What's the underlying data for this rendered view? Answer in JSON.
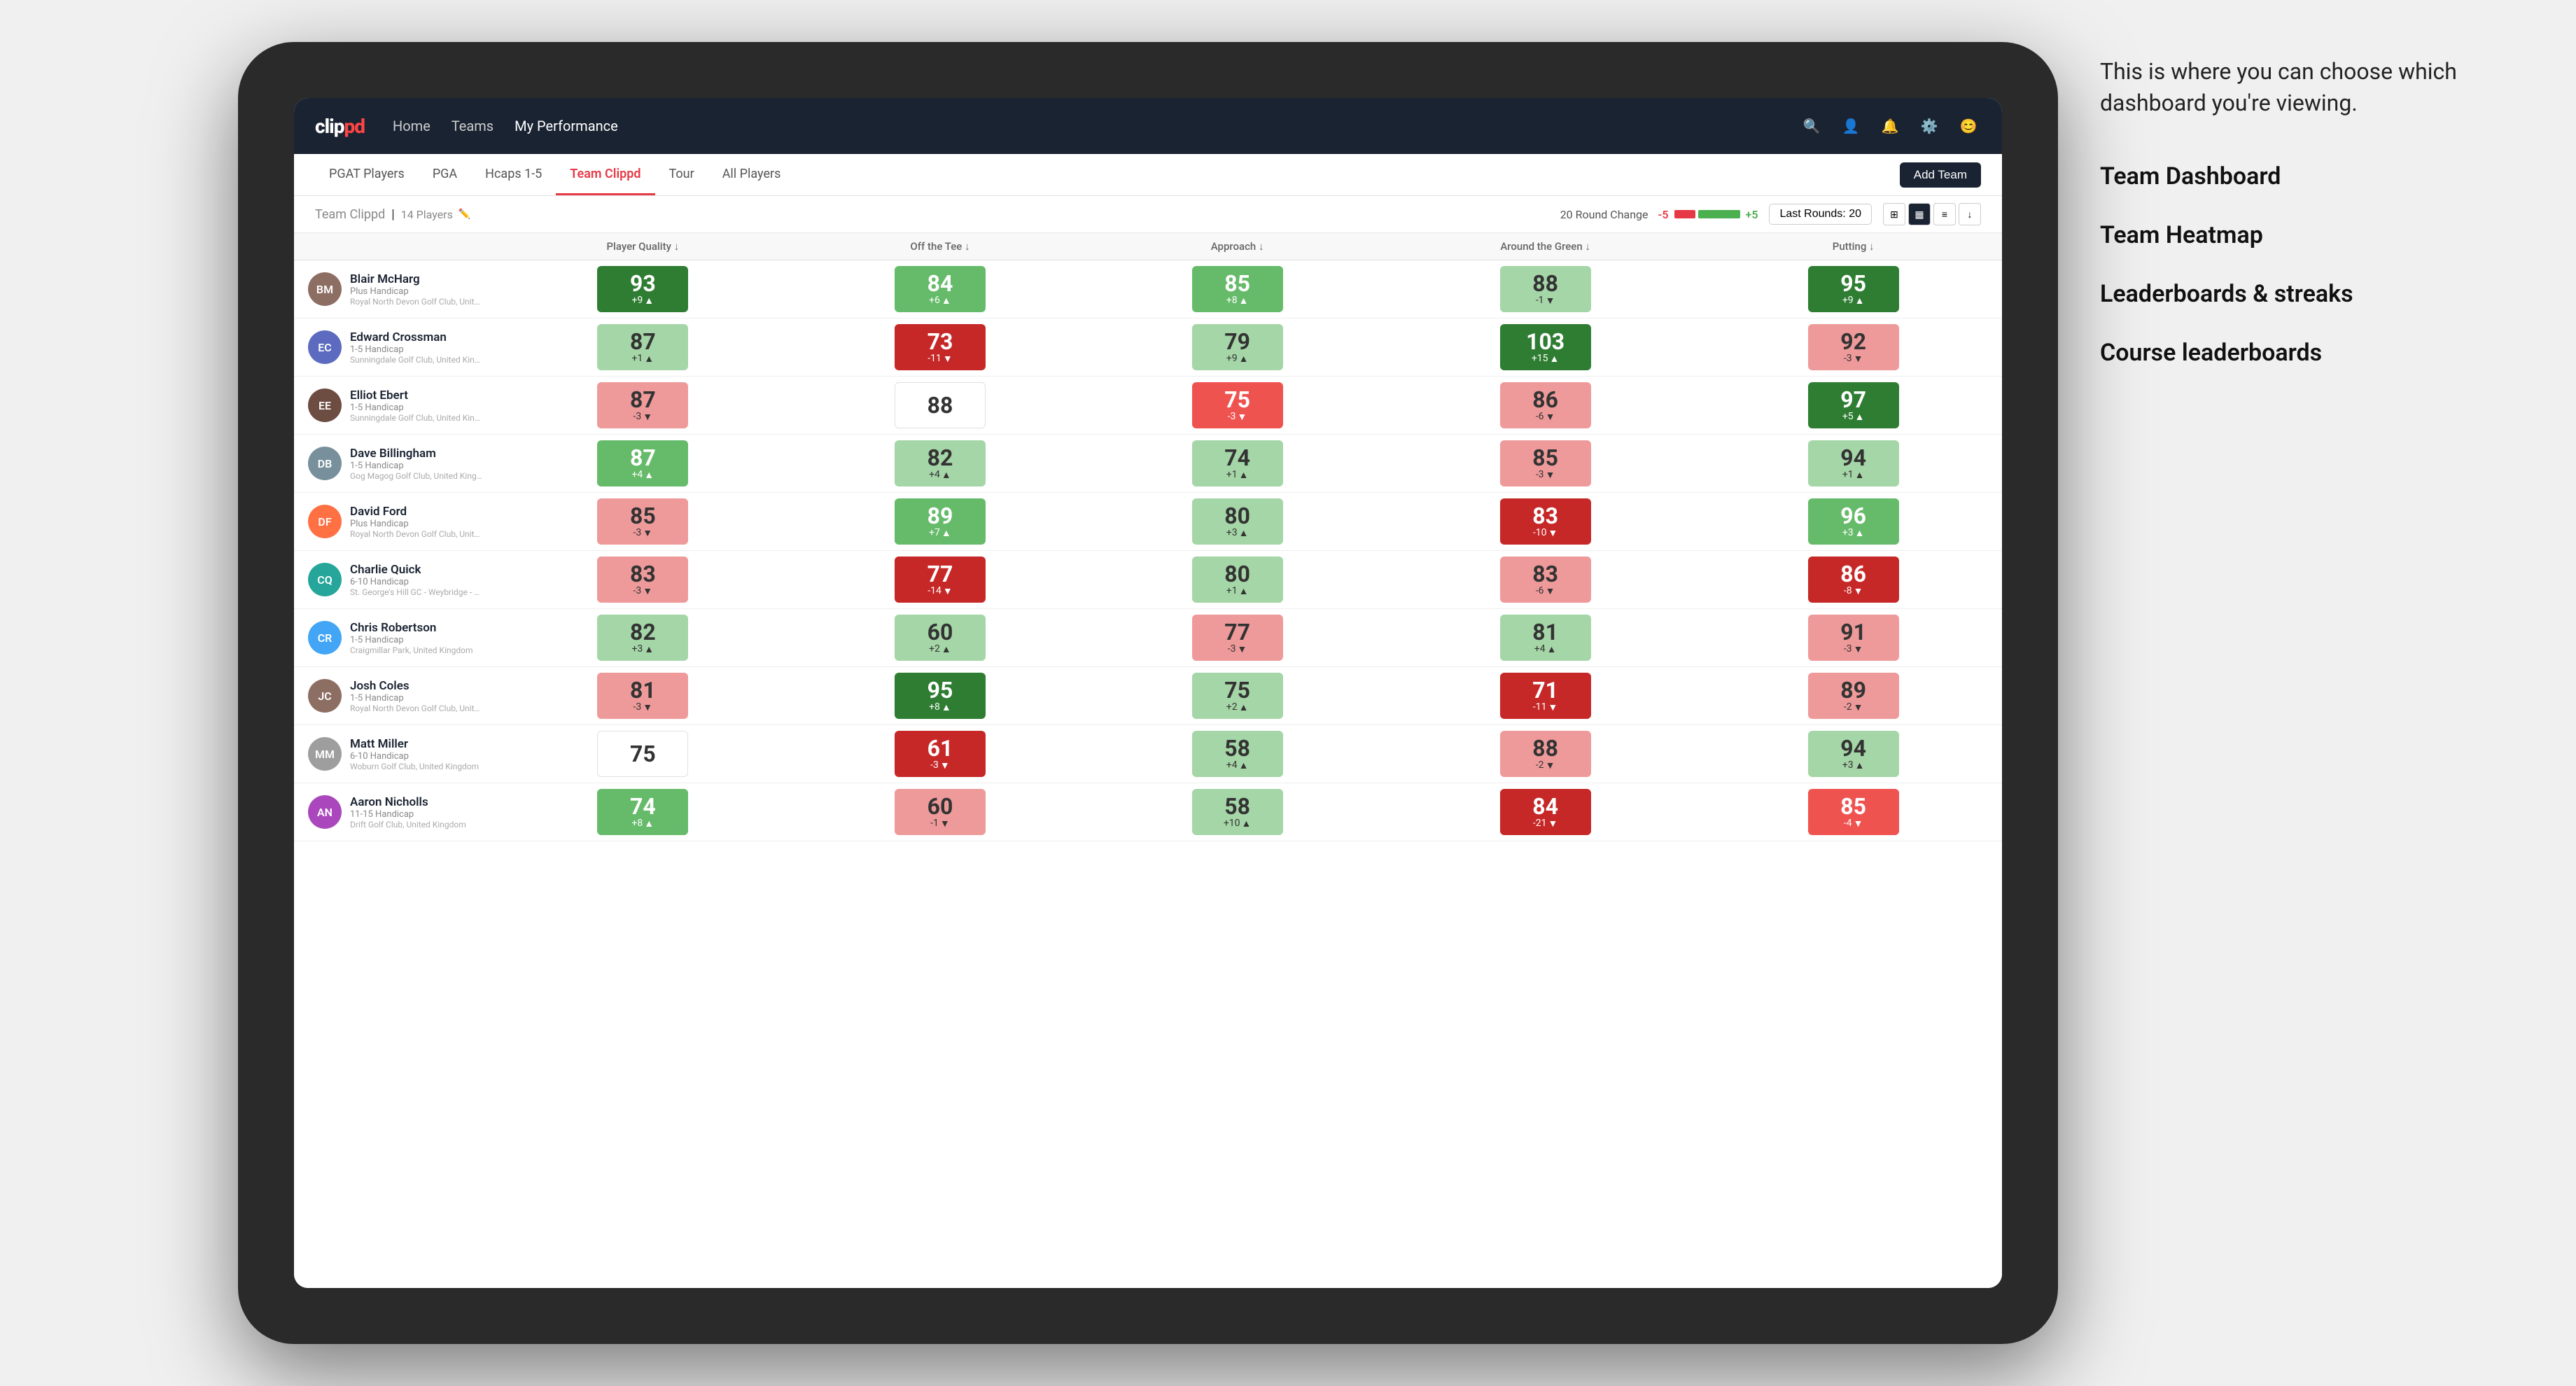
{
  "annotation": {
    "callout": "This is where you can choose which dashboard you're viewing.",
    "items": [
      "Team Dashboard",
      "Team Heatmap",
      "Leaderboards & streaks",
      "Course leaderboards"
    ]
  },
  "navbar": {
    "logo": "clippd",
    "nav_items": [
      "Home",
      "Teams",
      "My Performance"
    ],
    "active_nav": "My Performance"
  },
  "sub_tabs": {
    "tabs": [
      "PGAT Players",
      "PGA",
      "Hcaps 1-5",
      "Team Clippd",
      "Tour",
      "All Players"
    ],
    "active_tab": "Team Clippd",
    "add_team_label": "Add Team"
  },
  "team_header": {
    "team_name": "Team Clippd",
    "player_count": "14 Players",
    "round_change_label": "20 Round Change",
    "neg_label": "-5",
    "pos_label": "+5",
    "last_rounds_label": "Last Rounds: 20"
  },
  "table": {
    "columns": [
      "Player Quality ↓",
      "Off the Tee ↓",
      "Approach ↓",
      "Around the Green ↓",
      "Putting ↓"
    ],
    "players": [
      {
        "name": "Blair McHarg",
        "handicap": "Plus Handicap",
        "club": "Royal North Devon Golf Club, United Kingdom",
        "avatar_color": "#8d6e63",
        "initials": "BM",
        "scores": [
          {
            "value": 93,
            "change": "+9",
            "dir": "up",
            "color": "green-strong"
          },
          {
            "value": 84,
            "change": "+6",
            "dir": "up",
            "color": "green-mid"
          },
          {
            "value": 85,
            "change": "+8",
            "dir": "up",
            "color": "green-mid"
          },
          {
            "value": 88,
            "change": "-1",
            "dir": "down",
            "color": "green-light"
          },
          {
            "value": 95,
            "change": "+9",
            "dir": "up",
            "color": "green-strong"
          }
        ]
      },
      {
        "name": "Edward Crossman",
        "handicap": "1-5 Handicap",
        "club": "Sunningdale Golf Club, United Kingdom",
        "avatar_color": "#5c6bc0",
        "initials": "EC",
        "scores": [
          {
            "value": 87,
            "change": "+1",
            "dir": "up",
            "color": "green-light"
          },
          {
            "value": 73,
            "change": "-11",
            "dir": "down",
            "color": "red-strong"
          },
          {
            "value": 79,
            "change": "+9",
            "dir": "up",
            "color": "green-light"
          },
          {
            "value": 103,
            "change": "+15",
            "dir": "up",
            "color": "green-strong"
          },
          {
            "value": 92,
            "change": "-3",
            "dir": "down",
            "color": "red-light"
          }
        ]
      },
      {
        "name": "Elliot Ebert",
        "handicap": "1-5 Handicap",
        "club": "Sunningdale Golf Club, United Kingdom",
        "avatar_color": "#6d4c41",
        "initials": "EE",
        "scores": [
          {
            "value": 87,
            "change": "-3",
            "dir": "down",
            "color": "red-light"
          },
          {
            "value": 88,
            "change": "",
            "dir": "none",
            "color": "neutral"
          },
          {
            "value": 75,
            "change": "-3",
            "dir": "down",
            "color": "red-mid"
          },
          {
            "value": 86,
            "change": "-6",
            "dir": "down",
            "color": "red-light"
          },
          {
            "value": 97,
            "change": "+5",
            "dir": "up",
            "color": "green-strong"
          }
        ]
      },
      {
        "name": "Dave Billingham",
        "handicap": "1-5 Handicap",
        "club": "Gog Magog Golf Club, United Kingdom",
        "avatar_color": "#78909c",
        "initials": "DB",
        "scores": [
          {
            "value": 87,
            "change": "+4",
            "dir": "up",
            "color": "green-mid"
          },
          {
            "value": 82,
            "change": "+4",
            "dir": "up",
            "color": "green-light"
          },
          {
            "value": 74,
            "change": "+1",
            "dir": "up",
            "color": "green-light"
          },
          {
            "value": 85,
            "change": "-3",
            "dir": "down",
            "color": "red-light"
          },
          {
            "value": 94,
            "change": "+1",
            "dir": "up",
            "color": "green-light"
          }
        ]
      },
      {
        "name": "David Ford",
        "handicap": "Plus Handicap",
        "club": "Royal North Devon Golf Club, United Kingdom",
        "avatar_color": "#ff7043",
        "initials": "DF",
        "scores": [
          {
            "value": 85,
            "change": "-3",
            "dir": "down",
            "color": "red-light"
          },
          {
            "value": 89,
            "change": "+7",
            "dir": "up",
            "color": "green-mid"
          },
          {
            "value": 80,
            "change": "+3",
            "dir": "up",
            "color": "green-light"
          },
          {
            "value": 83,
            "change": "-10",
            "dir": "down",
            "color": "red-strong"
          },
          {
            "value": 96,
            "change": "+3",
            "dir": "up",
            "color": "green-mid"
          }
        ]
      },
      {
        "name": "Charlie Quick",
        "handicap": "6-10 Handicap",
        "club": "St. George's Hill GC - Weybridge - Surrey, Uni...",
        "avatar_color": "#26a69a",
        "initials": "CQ",
        "scores": [
          {
            "value": 83,
            "change": "-3",
            "dir": "down",
            "color": "red-light"
          },
          {
            "value": 77,
            "change": "-14",
            "dir": "down",
            "color": "red-strong"
          },
          {
            "value": 80,
            "change": "+1",
            "dir": "up",
            "color": "green-light"
          },
          {
            "value": 83,
            "change": "-6",
            "dir": "down",
            "color": "red-light"
          },
          {
            "value": 86,
            "change": "-8",
            "dir": "down",
            "color": "red-strong"
          }
        ]
      },
      {
        "name": "Chris Robertson",
        "handicap": "1-5 Handicap",
        "club": "Craigmillar Park, United Kingdom",
        "avatar_color": "#42a5f5",
        "initials": "CR",
        "scores": [
          {
            "value": 82,
            "change": "+3",
            "dir": "up",
            "color": "green-light"
          },
          {
            "value": 60,
            "change": "+2",
            "dir": "up",
            "color": "green-light"
          },
          {
            "value": 77,
            "change": "-3",
            "dir": "down",
            "color": "red-light"
          },
          {
            "value": 81,
            "change": "+4",
            "dir": "up",
            "color": "green-light"
          },
          {
            "value": 91,
            "change": "-3",
            "dir": "down",
            "color": "red-light"
          }
        ]
      },
      {
        "name": "Josh Coles",
        "handicap": "1-5 Handicap",
        "club": "Royal North Devon Golf Club, United Kingdom",
        "avatar_color": "#8d6e63",
        "initials": "JC",
        "scores": [
          {
            "value": 81,
            "change": "-3",
            "dir": "down",
            "color": "red-light"
          },
          {
            "value": 95,
            "change": "+8",
            "dir": "up",
            "color": "green-strong"
          },
          {
            "value": 75,
            "change": "+2",
            "dir": "up",
            "color": "green-light"
          },
          {
            "value": 71,
            "change": "-11",
            "dir": "down",
            "color": "red-strong"
          },
          {
            "value": 89,
            "change": "-2",
            "dir": "down",
            "color": "red-light"
          }
        ]
      },
      {
        "name": "Matt Miller",
        "handicap": "6-10 Handicap",
        "club": "Woburn Golf Club, United Kingdom",
        "avatar_color": "#9e9e9e",
        "initials": "MM",
        "scores": [
          {
            "value": 75,
            "change": "",
            "dir": "none",
            "color": "neutral"
          },
          {
            "value": 61,
            "change": "-3",
            "dir": "down",
            "color": "red-strong"
          },
          {
            "value": 58,
            "change": "+4",
            "dir": "up",
            "color": "green-light"
          },
          {
            "value": 88,
            "change": "-2",
            "dir": "down",
            "color": "red-light"
          },
          {
            "value": 94,
            "change": "+3",
            "dir": "up",
            "color": "green-light"
          }
        ]
      },
      {
        "name": "Aaron Nicholls",
        "handicap": "11-15 Handicap",
        "club": "Drift Golf Club, United Kingdom",
        "avatar_color": "#ab47bc",
        "initials": "AN",
        "scores": [
          {
            "value": 74,
            "change": "+8",
            "dir": "up",
            "color": "green-mid"
          },
          {
            "value": 60,
            "change": "-1",
            "dir": "down",
            "color": "red-light"
          },
          {
            "value": 58,
            "change": "+10",
            "dir": "up",
            "color": "green-light"
          },
          {
            "value": 84,
            "change": "-21",
            "dir": "down",
            "color": "red-strong"
          },
          {
            "value": 85,
            "change": "-4",
            "dir": "down",
            "color": "red-mid"
          }
        ]
      }
    ]
  }
}
